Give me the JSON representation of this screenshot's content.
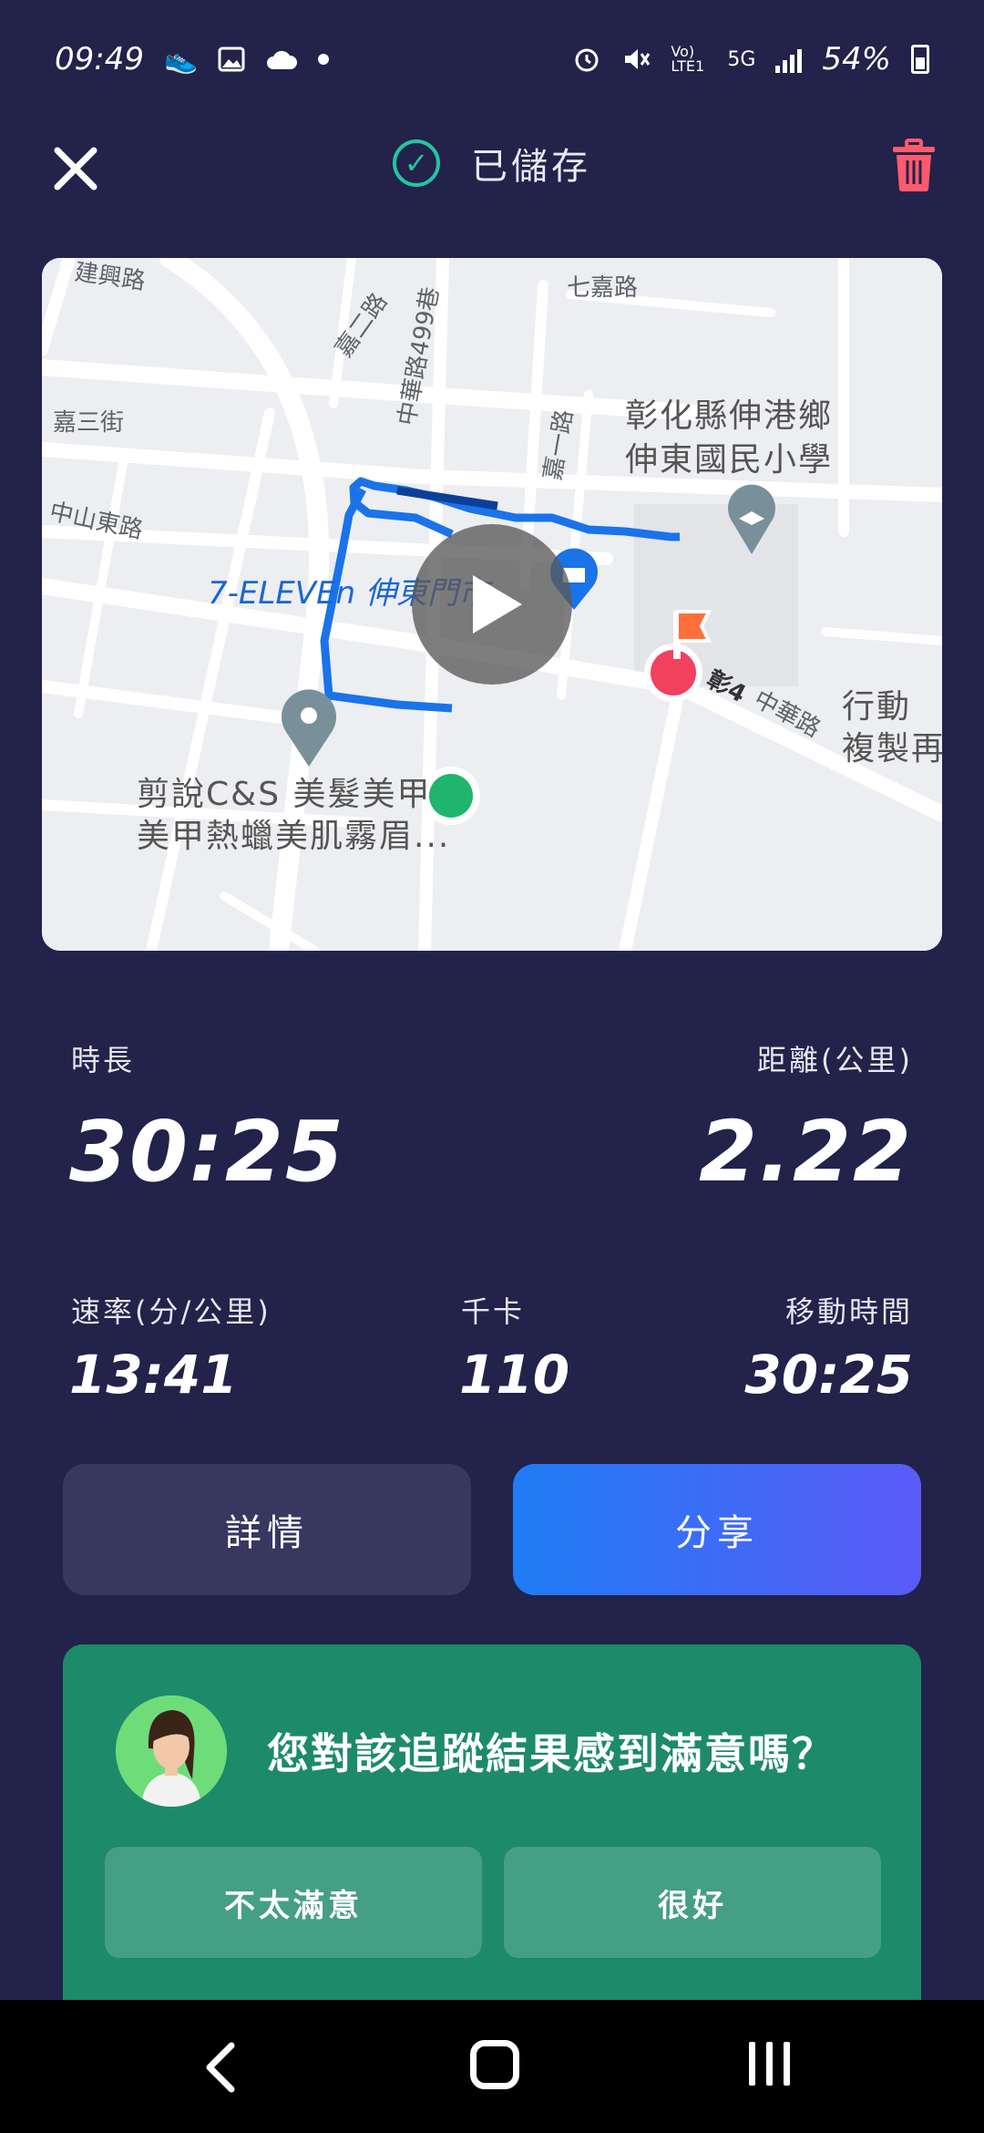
{
  "status_bar": {
    "time": "09:49",
    "network": "5G",
    "lte": "Vo) LTE1",
    "battery": "54%"
  },
  "header": {
    "saved_label": "已儲存"
  },
  "map": {
    "labels": {
      "road_jianxing": "建興路",
      "road_qijia": "七嘉路",
      "road_jiasan": "嘉三街",
      "road_jiaer": "嘉二路",
      "road_zhongshan_e": "中山東路",
      "lane_zhonghua_499": "中華路499巷",
      "road_jiayi": "嘉一路",
      "road_zhonghua": "中華路",
      "road_code": "彰4",
      "school": [
        "彰化縣伸港鄉",
        "伸東國民小學"
      ],
      "store": "7-ELEVEn 伸東門市",
      "salon": [
        "剪說C&S 美髮美甲",
        "美甲熱蠟美肌霧眉..."
      ],
      "edge_text": [
        "行動",
        "複製再"
      ]
    }
  },
  "stats": {
    "duration_label": "時長",
    "duration_value": "30:25",
    "distance_label": "距離(公里)",
    "distance_value": "2.22",
    "pace_label": "速率(分/公里)",
    "pace_value": "13:41",
    "kcal_label": "千卡",
    "kcal_value": "110",
    "moving_label": "移動時間",
    "moving_value": "30:25"
  },
  "actions": {
    "details_label": "詳情",
    "share_label": "分享"
  },
  "feedback": {
    "question": "您對該追蹤結果感到滿意嗎？",
    "not_satisfied": "不太滿意",
    "good": "很好"
  },
  "colors": {
    "background": "#22224a",
    "accent_green": "#25c4a0",
    "delete_red": "#ff5a6e",
    "share_start": "#1f7cf5",
    "share_end": "#5b5bf7",
    "feedback_bg": "#1d8a6a",
    "route_blue": "#1a73e8"
  }
}
